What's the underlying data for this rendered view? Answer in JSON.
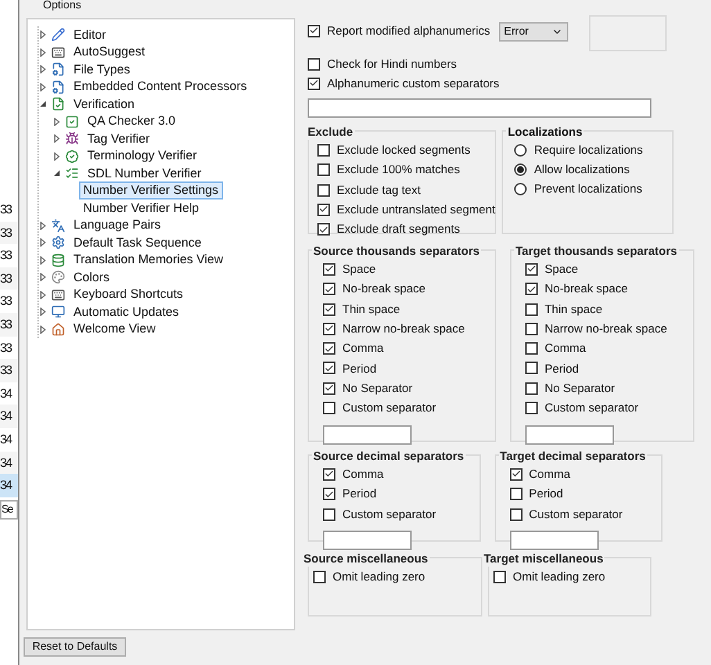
{
  "window": {
    "title": "Options"
  },
  "background_list": {
    "rows": [
      {
        "text": "33",
        "selected": false
      },
      {
        "text": "33",
        "selected": false
      },
      {
        "text": "33",
        "selected": false
      },
      {
        "text": "33",
        "selected": false
      },
      {
        "text": "33",
        "selected": false
      },
      {
        "text": "33",
        "selected": false
      },
      {
        "text": "33",
        "selected": false
      },
      {
        "text": "33",
        "selected": false
      },
      {
        "text": "34",
        "selected": false
      },
      {
        "text": "34",
        "selected": false
      },
      {
        "text": "34",
        "selected": false
      },
      {
        "text": "34",
        "selected": false
      },
      {
        "text": "34",
        "selected": true
      }
    ],
    "footer": "Se"
  },
  "tree": [
    {
      "label": "Editor",
      "expanded": false,
      "selected": false
    },
    {
      "label": "AutoSuggest",
      "expanded": false,
      "selected": false
    },
    {
      "label": "File Types",
      "expanded": false,
      "selected": false
    },
    {
      "label": "Embedded Content Processors",
      "expanded": false,
      "selected": false
    },
    {
      "label": "Verification",
      "expanded": true,
      "selected": false,
      "children": [
        {
          "label": "QA Checker 3.0",
          "expanded": false,
          "selected": false
        },
        {
          "label": "Tag Verifier",
          "expanded": false,
          "selected": false
        },
        {
          "label": "Terminology Verifier",
          "expanded": false,
          "selected": false
        },
        {
          "label": "SDL Number Verifier",
          "expanded": true,
          "selected": false,
          "children": [
            {
              "label": "Number Verifier Settings",
              "selected": true
            },
            {
              "label": "Number Verifier Help",
              "selected": false
            }
          ]
        }
      ]
    },
    {
      "label": "Language Pairs",
      "expanded": false,
      "selected": false
    },
    {
      "label": "Default Task Sequence",
      "expanded": false,
      "selected": false
    },
    {
      "label": "Translation Memories View",
      "expanded": false,
      "selected": false
    },
    {
      "label": "Colors",
      "expanded": false,
      "selected": false
    },
    {
      "label": "Keyboard Shortcuts",
      "expanded": false,
      "selected": false
    },
    {
      "label": "Automatic Updates",
      "expanded": false,
      "selected": false
    },
    {
      "label": "Welcome View",
      "expanded": false,
      "selected": false
    }
  ],
  "top_options": [
    {
      "label": "Report modified alphanumerics",
      "checked": true
    },
    {
      "label": "Check for Hindi numbers",
      "checked": false
    },
    {
      "label": "Alphanumeric custom separators",
      "checked": true
    }
  ],
  "severity_dropdown": {
    "value": "Error"
  },
  "exclude": {
    "title": "Exclude",
    "items": [
      {
        "label": "Exclude locked segments",
        "checked": false
      },
      {
        "label": "Exclude 100% matches",
        "checked": false
      },
      {
        "label": "Exclude tag text",
        "checked": false
      },
      {
        "label": "Exclude untranslated segment",
        "checked": true
      },
      {
        "label": "Exclude draft segments",
        "checked": true
      }
    ]
  },
  "localizations": {
    "title": "Localizations",
    "options": [
      {
        "label": "Require localizations",
        "selected": false
      },
      {
        "label": "Allow localizations",
        "selected": true
      },
      {
        "label": "Prevent localizations",
        "selected": false
      }
    ]
  },
  "source_thousands": {
    "title": "Source thousands separators",
    "items": [
      {
        "label": "Space",
        "checked": true
      },
      {
        "label": "No-break space",
        "checked": true
      },
      {
        "label": "Thin space",
        "checked": true
      },
      {
        "label": "Narrow no-break space",
        "checked": true
      },
      {
        "label": "Comma",
        "checked": true
      },
      {
        "label": "Period",
        "checked": true
      },
      {
        "label": "No Separator",
        "checked": true
      },
      {
        "label": "Custom separator",
        "checked": false
      }
    ]
  },
  "target_thousands": {
    "title": "Target thousands separators",
    "items": [
      {
        "label": "Space",
        "checked": true
      },
      {
        "label": "No-break space",
        "checked": true
      },
      {
        "label": "Thin space",
        "checked": false
      },
      {
        "label": "Narrow no-break space",
        "checked": false
      },
      {
        "label": "Comma",
        "checked": false
      },
      {
        "label": "Period",
        "checked": false
      },
      {
        "label": "No Separator",
        "checked": false
      },
      {
        "label": "Custom separator",
        "checked": false
      }
    ]
  },
  "source_decimal": {
    "title": "Source decimal separators",
    "items": [
      {
        "label": "Comma",
        "checked": true
      },
      {
        "label": "Period",
        "checked": true
      },
      {
        "label": "Custom separator",
        "checked": false
      }
    ]
  },
  "target_decimal": {
    "title": "Target decimal separators",
    "items": [
      {
        "label": "Comma",
        "checked": true
      },
      {
        "label": "Period",
        "checked": false
      },
      {
        "label": "Custom separator",
        "checked": false
      }
    ]
  },
  "source_misc": {
    "title": "Source miscellaneous",
    "items": [
      {
        "label": "Omit leading zero",
        "checked": false
      }
    ]
  },
  "target_misc": {
    "title": "Target miscellaneous",
    "items": [
      {
        "label": "Omit leading zero",
        "checked": false
      }
    ]
  },
  "reset_button": {
    "label": "Reset to Defaults"
  }
}
